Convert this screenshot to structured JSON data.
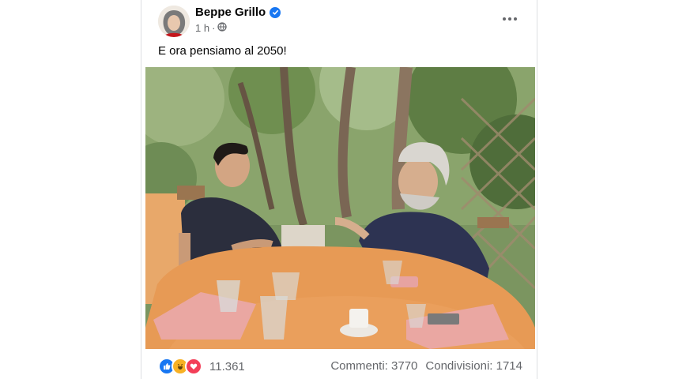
{
  "post": {
    "author": "Beppe Grillo",
    "time": "1 h",
    "separator": "·",
    "text": "E ora pensiamo al 2050!"
  },
  "reactions": {
    "icons": [
      "like-icon",
      "haha-icon",
      "love-icon"
    ],
    "count": "11.361"
  },
  "stats": {
    "comments_label": "Commenti:",
    "comments_value": "3770",
    "shares_label": "Condivisioni:",
    "shares_value": "1714"
  },
  "colors": {
    "brand_blue": "#1877f2",
    "secondary_text": "#65676b",
    "love_red": "#f33e58",
    "haha_yellow": "#f7b125"
  }
}
